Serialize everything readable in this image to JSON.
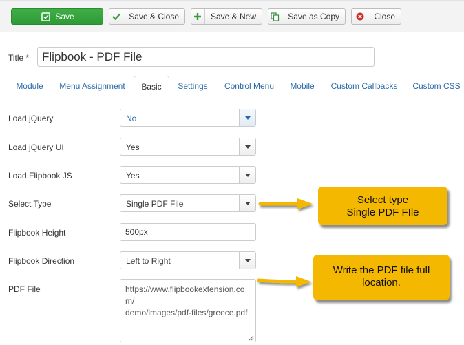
{
  "toolbar": {
    "save_label": "Save",
    "save_close_label": "Save & Close",
    "save_new_label": "Save & New",
    "save_copy_label": "Save as Copy",
    "close_label": "Close"
  },
  "title": {
    "label": "Title *",
    "value": "Flipbook - PDF File"
  },
  "tabs": [
    {
      "label": "Module",
      "active": false
    },
    {
      "label": "Menu Assignment",
      "active": false
    },
    {
      "label": "Basic",
      "active": true
    },
    {
      "label": "Settings",
      "active": false
    },
    {
      "label": "Control Menu",
      "active": false
    },
    {
      "label": "Mobile",
      "active": false
    },
    {
      "label": "Custom Callbacks",
      "active": false
    },
    {
      "label": "Custom CSS",
      "active": false
    }
  ],
  "fields": {
    "load_jquery": {
      "label": "Load jQuery",
      "value": "No"
    },
    "load_jquery_ui": {
      "label": "Load jQuery UI",
      "value": "Yes"
    },
    "load_flipbook_js": {
      "label": "Load Flipbook JS",
      "value": "Yes"
    },
    "select_type": {
      "label": "Select Type",
      "value": "Single PDF File"
    },
    "flipbook_height": {
      "label": "Flipbook Height",
      "value": "500px"
    },
    "flipbook_direction": {
      "label": "Flipbook Direction",
      "value": "Left to Right"
    },
    "pdf_file": {
      "label": "PDF File",
      "value": "https://www.flipbookextension.com/\ndemo/images/pdf-files/greece.pdf"
    }
  },
  "callouts": {
    "select_type_line1": "Select type",
    "select_type_line2": "Single PDF FIle",
    "pdf_file_line1": "Write the PDF file full",
    "pdf_file_line2": "location."
  },
  "colors": {
    "save_green": "#3fae46",
    "link_blue": "#2a6aa8",
    "callout_yellow": "#f5b800"
  },
  "icons": {
    "save": "save-icon",
    "save_close": "check-icon",
    "save_new": "plus-icon",
    "save_copy": "copy-icon",
    "close": "close-circle-icon",
    "dropdown": "caret-down-icon"
  }
}
